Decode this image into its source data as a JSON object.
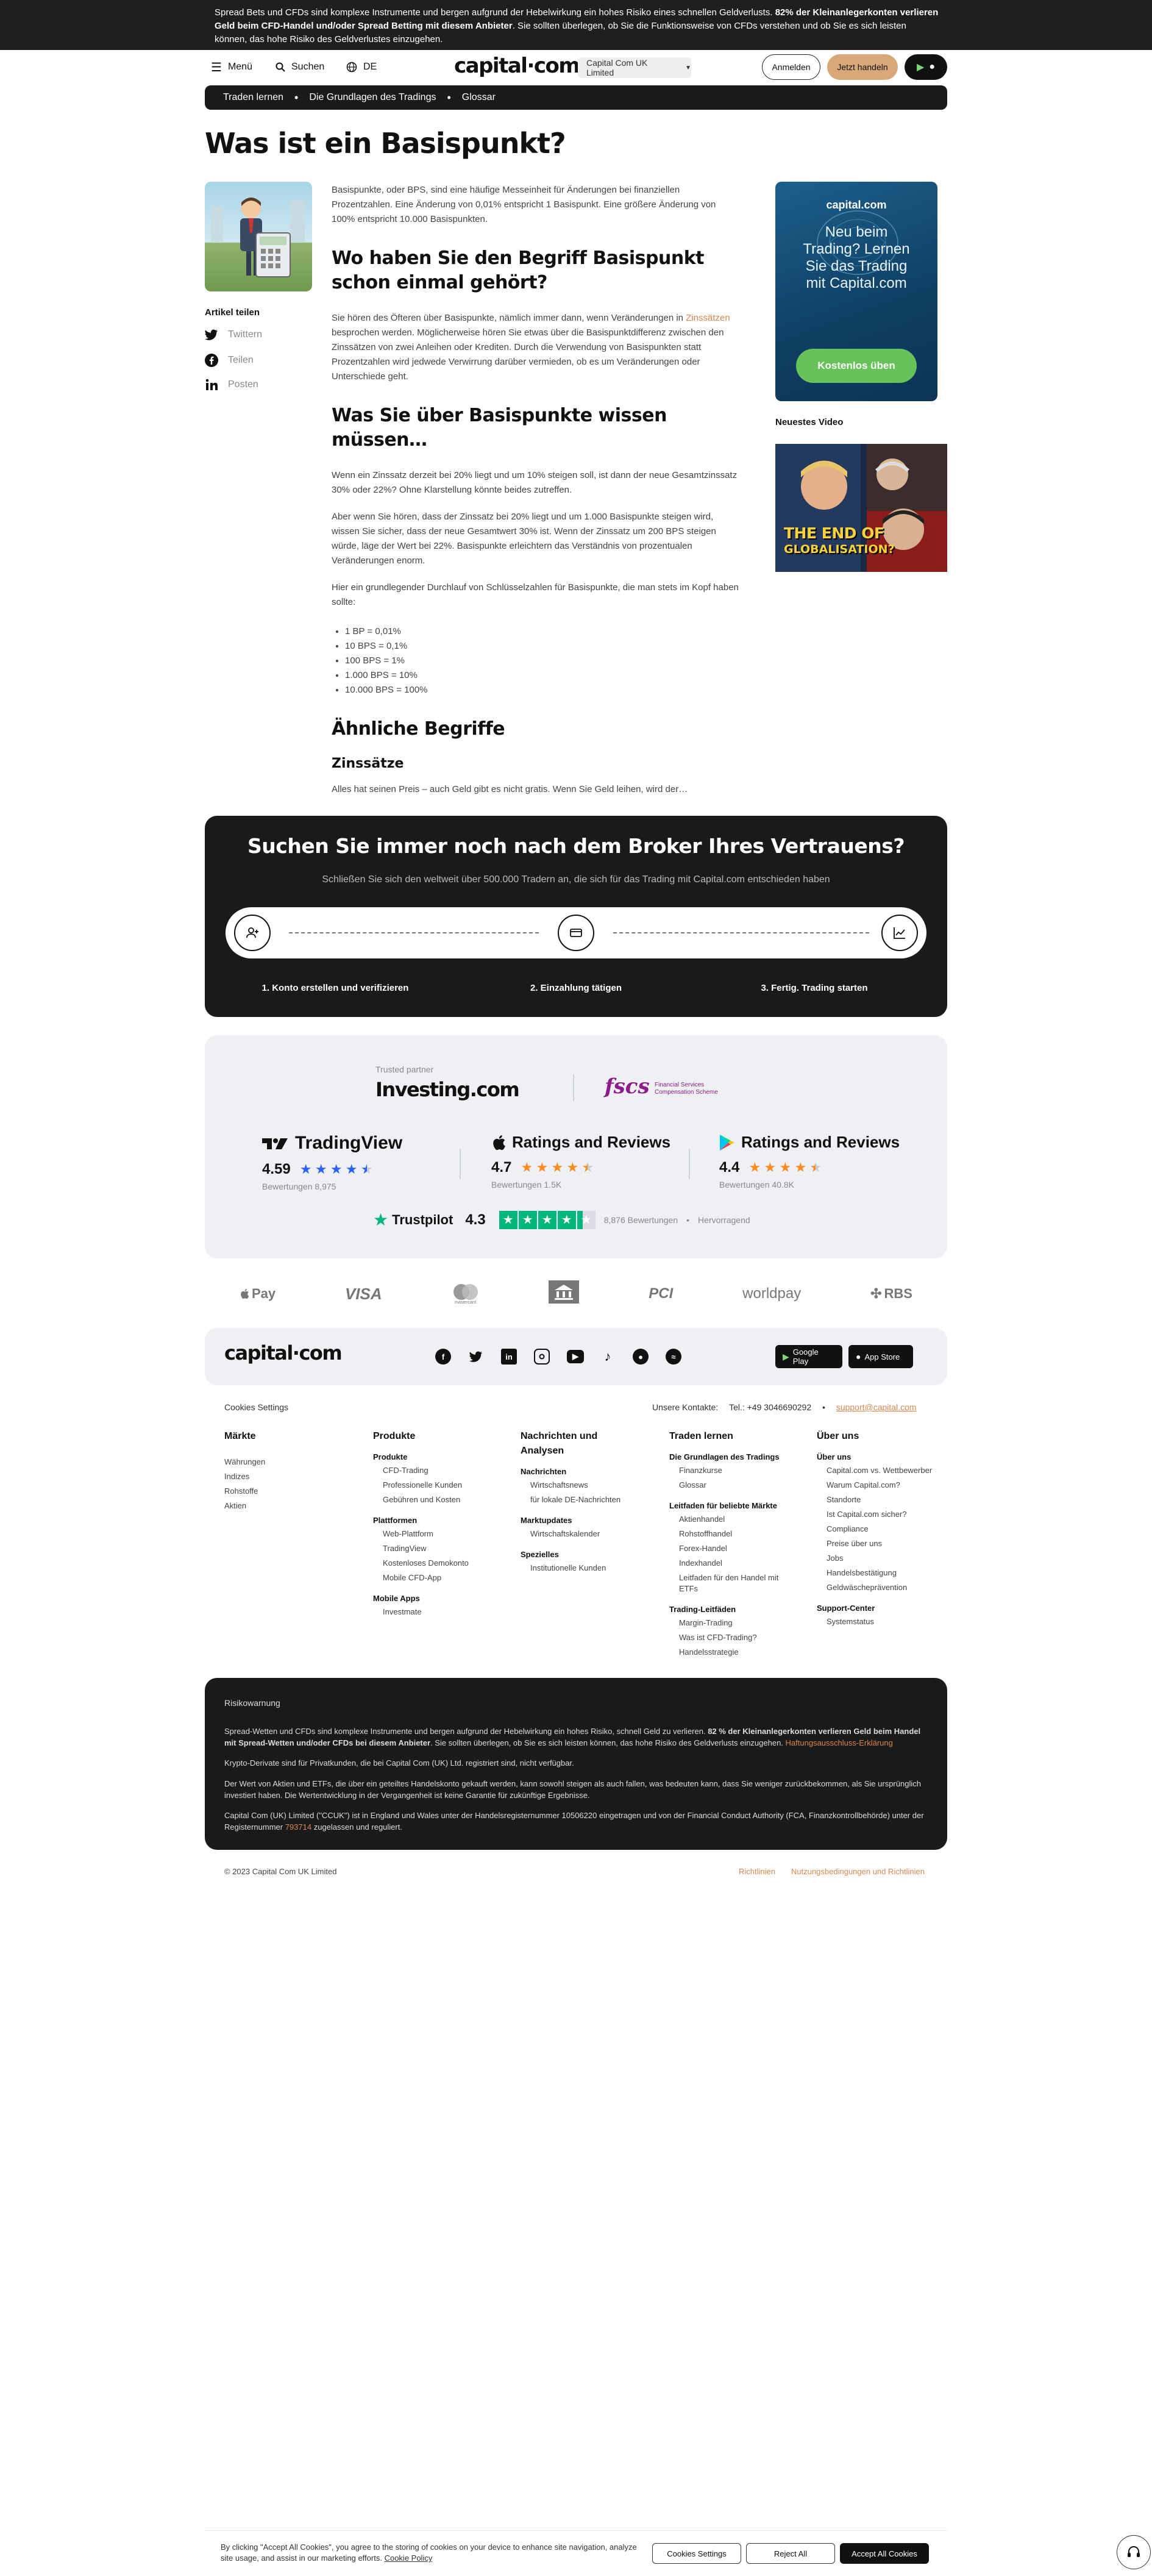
{
  "risk_banner": {
    "text_start": "Spread Bets und CFDs sind komplexe Instrumente und bergen aufgrund der Hebelwirkung ein hohes Risiko eines schnellen Geldverlusts. ",
    "text_bold": "82% der Kleinanlegerkonten verlieren Geld beim CFD-Handel und/oder Spread Betting mit diesem Anbieter",
    "text_end": ". Sie sollten überlegen, ob Sie die Funktionsweise von CFDs verstehen und ob Sie es sich leisten können, das hohe Risiko des Geldverlustes einzugehen."
  },
  "header": {
    "menu_label": "Menü",
    "search_label": "Suchen",
    "language": "DE",
    "logo": "capital·com",
    "entity": "Capital Com UK Limited",
    "login": "Anmelden",
    "trade_now": "Jetzt handeln"
  },
  "breadcrumb": [
    "Traden lernen",
    "Die Grundlagen des Tradings",
    "Glossar"
  ],
  "page_title": "Was ist ein Basispunkt?",
  "share": {
    "title": "Artikel teilen",
    "twitter": "Twittern",
    "facebook": "Teilen",
    "linkedin": "Posten"
  },
  "article": {
    "intro": "Basispunkte, oder BPS, sind eine häufige Messeinheit für Änderungen bei finanziellen Prozentzahlen. Eine Änderung von 0,01% entspricht 1 Basispunkt. Eine größere Änderung von 100% entspricht 10.000 Basispunkten.",
    "h2_heard": "Wo haben Sie den Begriff Basispunkt schon einmal gehört?",
    "heard_p_start": "Sie hören des Öfteren über Basispunkte, nämlich immer dann, wenn Veränderungen in ",
    "heard_p_link": "Zinssätzen",
    "heard_p_end": " besprochen werden. Möglicherweise hören Sie etwas über die Basispunktdifferenz zwischen den Zinssätzen von zwei Anleihen oder Krediten. Durch die Verwendung von Basispunkten statt Prozentzahlen wird jedwede Verwirrung darüber vermieden, ob es um Veränderungen oder Unterschiede geht.",
    "h2_know": "Was Sie über Basispunkte wissen müssen…",
    "know_p1": "Wenn ein Zinssatz derzeit bei 20% liegt und um 10% steigen soll, ist dann der neue Gesamtzinssatz 30% oder 22%? Ohne Klarstellung könnte beides zutreffen.",
    "know_p2": "Aber wenn Sie hören, dass der Zinssatz bei 20% liegt und um 1.000 Basispunkte steigen wird, wissen Sie sicher, dass der neue Gesamtwert 30% ist. Wenn der Zinssatz um 200 BPS steigen würde, läge der Wert bei 22%. Basispunkte erleichtern das Verständnis von prozentualen Veränderungen enorm.",
    "know_p3": "Hier ein grundlegender Durchlauf von Schlüsselzahlen für Basispunkte, die man stets im Kopf haben sollte:",
    "list": [
      "1 BP = 0,01%",
      "10 BPS = 0,1%",
      "100 BPS = 1%",
      "1.000 BPS = 10%",
      "10.000 BPS = 100%"
    ],
    "h2_similar": "Ähnliche Begriffe",
    "h3_rates": "Zinssätze",
    "rates_p": "Alles hat seinen Preis – auch Geld gibt es nicht gratis. Wenn Sie Geld leihen, wird der…"
  },
  "promo": {
    "logo": "capital.com",
    "text": "Neu beim Trading? Lernen Sie das Trading mit Capital.com",
    "button": "Kostenlos üben"
  },
  "video": {
    "label": "Neuestes Video",
    "caption_line1": "THE END OF",
    "caption_line2": "GLOBALISATION?"
  },
  "broker": {
    "title": "Suchen Sie immer noch nach dem Broker Ihres Vertrauens?",
    "subtitle": "Schließen Sie sich den weltweit über 500.000 Tradern an, die sich für das Trading mit Capital.com entschieden haben",
    "steps": [
      "1. Konto erstellen und verifizieren",
      "2. Einzahlung tätigen",
      "3. Fertig. Trading starten"
    ]
  },
  "trust": {
    "partner_label": "Trusted partner",
    "partner_name": "Investing.com",
    "fscs": "fscs",
    "fscs_sub1": "Financial Services",
    "fscs_sub2": "Compensation Scheme",
    "ratings": [
      {
        "name": "TradingView",
        "score": "4.59",
        "count": "Bewertungen 8,975",
        "stars": 4.5,
        "color": "#2962ff"
      },
      {
        "name": "Ratings and Reviews",
        "score": "4.7",
        "count": "Bewertungen 1.5K",
        "stars": 4.5,
        "color": "#ff8a1f"
      },
      {
        "name": "Ratings and Reviews",
        "score": "4.4",
        "count": "Bewertungen 40.8K",
        "stars": 4.5,
        "color": "#ff8a1f"
      }
    ],
    "trustpilot_name": "Trustpilot",
    "trustpilot_score": "4.3",
    "trustpilot_count": "8,876 Bewertungen",
    "trustpilot_label": "Hervorragend"
  },
  "payments": [
    "Pay",
    "VISA",
    "mastercard",
    "",
    "PCI",
    "worldpay",
    "RBS"
  ],
  "footer": {
    "logo": "capital·com",
    "google_play": "Google Play",
    "app_store": "App Store",
    "cookies_settings": "Cookies Settings",
    "contacts_label": "Unsere Kontakte:",
    "phone": "Tel.: +49 3046690292",
    "email": "support@capital.com",
    "columns": [
      {
        "title": "Märkte",
        "groups": [
          {
            "sub": "",
            "links": [
              "Währungen",
              "Indizes",
              "Rohstoffe",
              "Aktien"
            ]
          }
        ]
      },
      {
        "title": "Produkte",
        "groups": [
          {
            "sub": "Produkte",
            "links": [
              "CFD-Trading",
              "Professionelle Kunden",
              "Gebühren und Kosten"
            ]
          },
          {
            "sub": "Plattformen",
            "links": [
              "Web-Plattform",
              "TradingView",
              "Kostenloses Demokonto",
              "Mobile CFD-App"
            ]
          },
          {
            "sub": "Mobile Apps",
            "links": [
              "Investmate"
            ]
          }
        ]
      },
      {
        "title": "Nachrichten und Analysen",
        "groups": [
          {
            "sub": "Nachrichten",
            "links": [
              "Wirtschaftsnews",
              "für lokale DE-Nachrichten"
            ]
          },
          {
            "sub": "Marktupdates",
            "links": [
              "Wirtschaftskalender"
            ]
          },
          {
            "sub": "Spezielles",
            "links": [
              "Institutionelle Kunden"
            ]
          }
        ]
      },
      {
        "title": "Traden lernen",
        "groups": [
          {
            "sub": "Die Grundlagen des Tradings",
            "links": [
              "Finanzkurse",
              "Glossar"
            ]
          },
          {
            "sub": "Leitfaden für beliebte Märkte",
            "links": [
              "Aktienhandel",
              "Rohstoffhandel",
              "Forex-Handel",
              "Indexhandel",
              "Leitfaden für den Handel mit ETFs"
            ]
          },
          {
            "sub": "Trading-Leitfäden",
            "links": [
              "Margin-Trading",
              "Was ist CFD-Trading?",
              "Handelsstrategie"
            ]
          }
        ]
      },
      {
        "title": "Über uns",
        "groups": [
          {
            "sub": "Über uns",
            "links": [
              "Capital.com vs. Wettbewerber",
              "Warum Capital.com?",
              "Standorte",
              "Ist Capital.com sicher?",
              "Compliance",
              "Preise über uns",
              "Jobs",
              "Handelsbestätigung",
              "Geldwäscheprävention"
            ]
          },
          {
            "sub": "Support-Center",
            "links": [
              "Systemstatus"
            ]
          }
        ]
      }
    ]
  },
  "risk_footer": {
    "title": "Risikowarnung",
    "p1_start": "Spread-Wetten und CFDs sind komplexe Instrumente und bergen aufgrund der Hebelwirkung ein hohes Risiko, schnell Geld zu verlieren. ",
    "p1_bold": "82 % der Kleinanlegerkonten verlieren Geld beim Handel mit Spread-Wetten und/oder CFDs bei diesem Anbieter",
    "p1_end": ". Sie sollten überlegen, ob Sie es sich leisten können, das hohe Risiko des Geldverlusts einzugehen. ",
    "p1_link": "Haftungsausschluss-Erklärung",
    "p2": "Krypto-Derivate sind für Privatkunden, die bei Capital Com (UK) Ltd. registriert sind, nicht verfügbar.",
    "p3": "Der Wert von Aktien und ETFs, die über ein geteiltes Handelskonto gekauft werden, kann sowohl steigen als auch fallen, was bedeuten kann, dass Sie weniger zurückbekommen, als Sie ursprünglich investiert haben. Die Wertentwicklung in der Vergangenheit ist keine Garantie für zukünftige Ergebnisse.",
    "p4_start": "Capital Com (UK) Limited (\"CCUK\") ist in England und Wales unter der Handelsregisternummer 10506220 eingetragen und von der Financial Conduct Authority (FCA, Finanzkontrollbehörde) unter der Registernummer ",
    "p4_link": "793714",
    "p4_end": " zugelassen und reguliert."
  },
  "copyright": "© 2023 Capital Com UK Limited",
  "legal_links": [
    "Richtlinien",
    "Nutzungsbedingungen und Richtlinien"
  ],
  "cookie_banner": {
    "text": "By clicking \"Accept All Cookies\", you agree to the storing of cookies on your device to enhance site navigation, analyze site usage, and assist in our marketing efforts.",
    "policy_link": "Cookie Policy",
    "settings": "Cookies Settings",
    "reject": "Reject All",
    "accept": "Accept All Cookies"
  }
}
